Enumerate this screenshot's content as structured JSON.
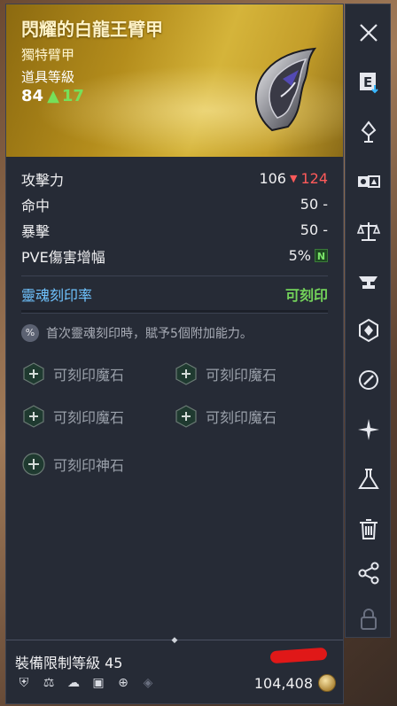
{
  "item": {
    "name": "閃耀的白龍王臂甲",
    "grade": "獨特臂甲",
    "level_label": "道具等級",
    "level": "84",
    "level_up": "17"
  },
  "stats": [
    {
      "name": "攻擊力",
      "value": "106",
      "new_value": "124",
      "arrow": "▼"
    },
    {
      "name": "命中",
      "value": "50 -"
    },
    {
      "name": "暴擊",
      "value": "50 -"
    },
    {
      "name": "PVE傷害增幅",
      "value": "5%",
      "badge": "N"
    }
  ],
  "engrave": {
    "label": "靈魂刻印率",
    "status": "可刻印",
    "notice_icon": "%",
    "notice": "首次靈魂刻印時，賦予5個附加能力。"
  },
  "slots": [
    "可刻印魔石",
    "可刻印魔石",
    "可刻印魔石",
    "可刻印魔石"
  ],
  "god_slot": "可刻印神石",
  "footer": {
    "required_level": "裝備限制等級 45",
    "price": "104,408",
    "class_icons": [
      "class-warrior-icon",
      "class-scale-icon",
      "class-book-icon",
      "class-card-icon",
      "class-target-icon",
      "class-diamond-icon"
    ]
  },
  "sidebar": [
    "close-icon",
    "equip-icon",
    "upgrade-icon",
    "compare-icon",
    "balance-icon",
    "anvil-icon",
    "soul-gem-icon",
    "link-icon",
    "sparkle-icon",
    "flask-icon",
    "trash-icon",
    "share-icon",
    "lock-icon"
  ],
  "colors": {
    "header_gold": "#b48d1c",
    "stat_down": "#ff5a5a",
    "engrave_label": "#6fc3ff",
    "engrave_status": "#73d25a"
  }
}
